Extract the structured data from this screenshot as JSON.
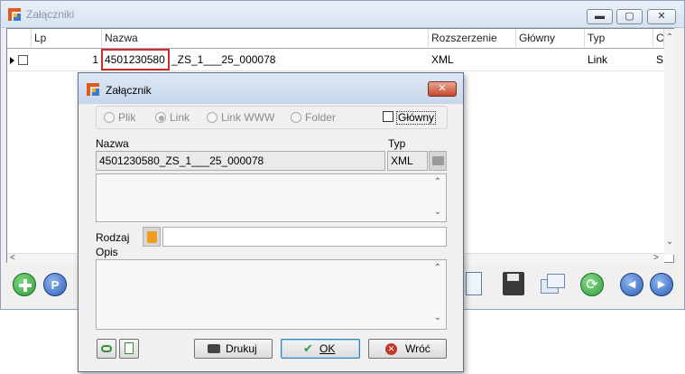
{
  "main_window": {
    "title": "Załączniki",
    "columns": [
      "Lp",
      "Nazwa",
      "Rozszerzenie",
      "Główny",
      "Typ",
      "C"
    ],
    "row": {
      "lp": "1",
      "nazwa_highlight": "4501230580",
      "nazwa_rest": "_ZS_1___25_000078",
      "rozszerzenie": "XML",
      "typ": "Link",
      "c": "S"
    }
  },
  "dialog": {
    "title": "Załącznik",
    "radios": [
      {
        "label": "Plik",
        "selected": false
      },
      {
        "label": "Link",
        "selected": true
      },
      {
        "label": "Link WWW",
        "selected": false
      },
      {
        "label": "Folder",
        "selected": false
      }
    ],
    "glowny_label": "Główny",
    "nazwa_label": "Nazwa",
    "nazwa_value": "4501230580_ZS_1___25_000078",
    "typ_label": "Typ",
    "typ_value": "XML",
    "rodzaj_label": "Rodzaj",
    "rodzaj_value": "",
    "opis_label": "Opis",
    "opis_value": "",
    "drukuj_label": "Drukuj",
    "ok_label": "OK",
    "wroc_label": "Wróć"
  },
  "colors": {
    "highlight": "#d12b2b",
    "accent": "#3c7fb1",
    "add_green": "#2f9e3a",
    "nav_blue": "#2f5fb5",
    "cancel_red": "#c0392b"
  }
}
